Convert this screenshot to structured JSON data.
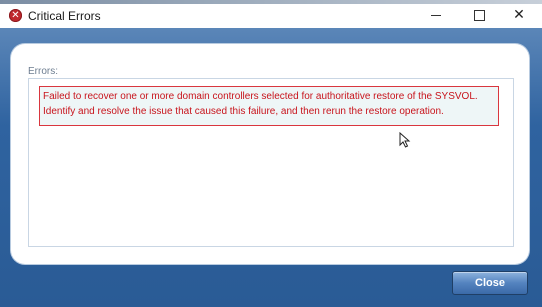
{
  "window": {
    "title": "Critical Errors",
    "icon": "error-icon"
  },
  "errors": {
    "label": "Errors:",
    "message": "Failed to recover one or more domain controllers selected for authoritative restore of the SYSVOL. Identify and resolve the issue that caused this failure, and then rerun the restore operation."
  },
  "actions": {
    "close_label": "Close"
  },
  "colors": {
    "error_text": "#c8141c",
    "error_border": "#d9363e",
    "accent": "#2f63a0"
  }
}
